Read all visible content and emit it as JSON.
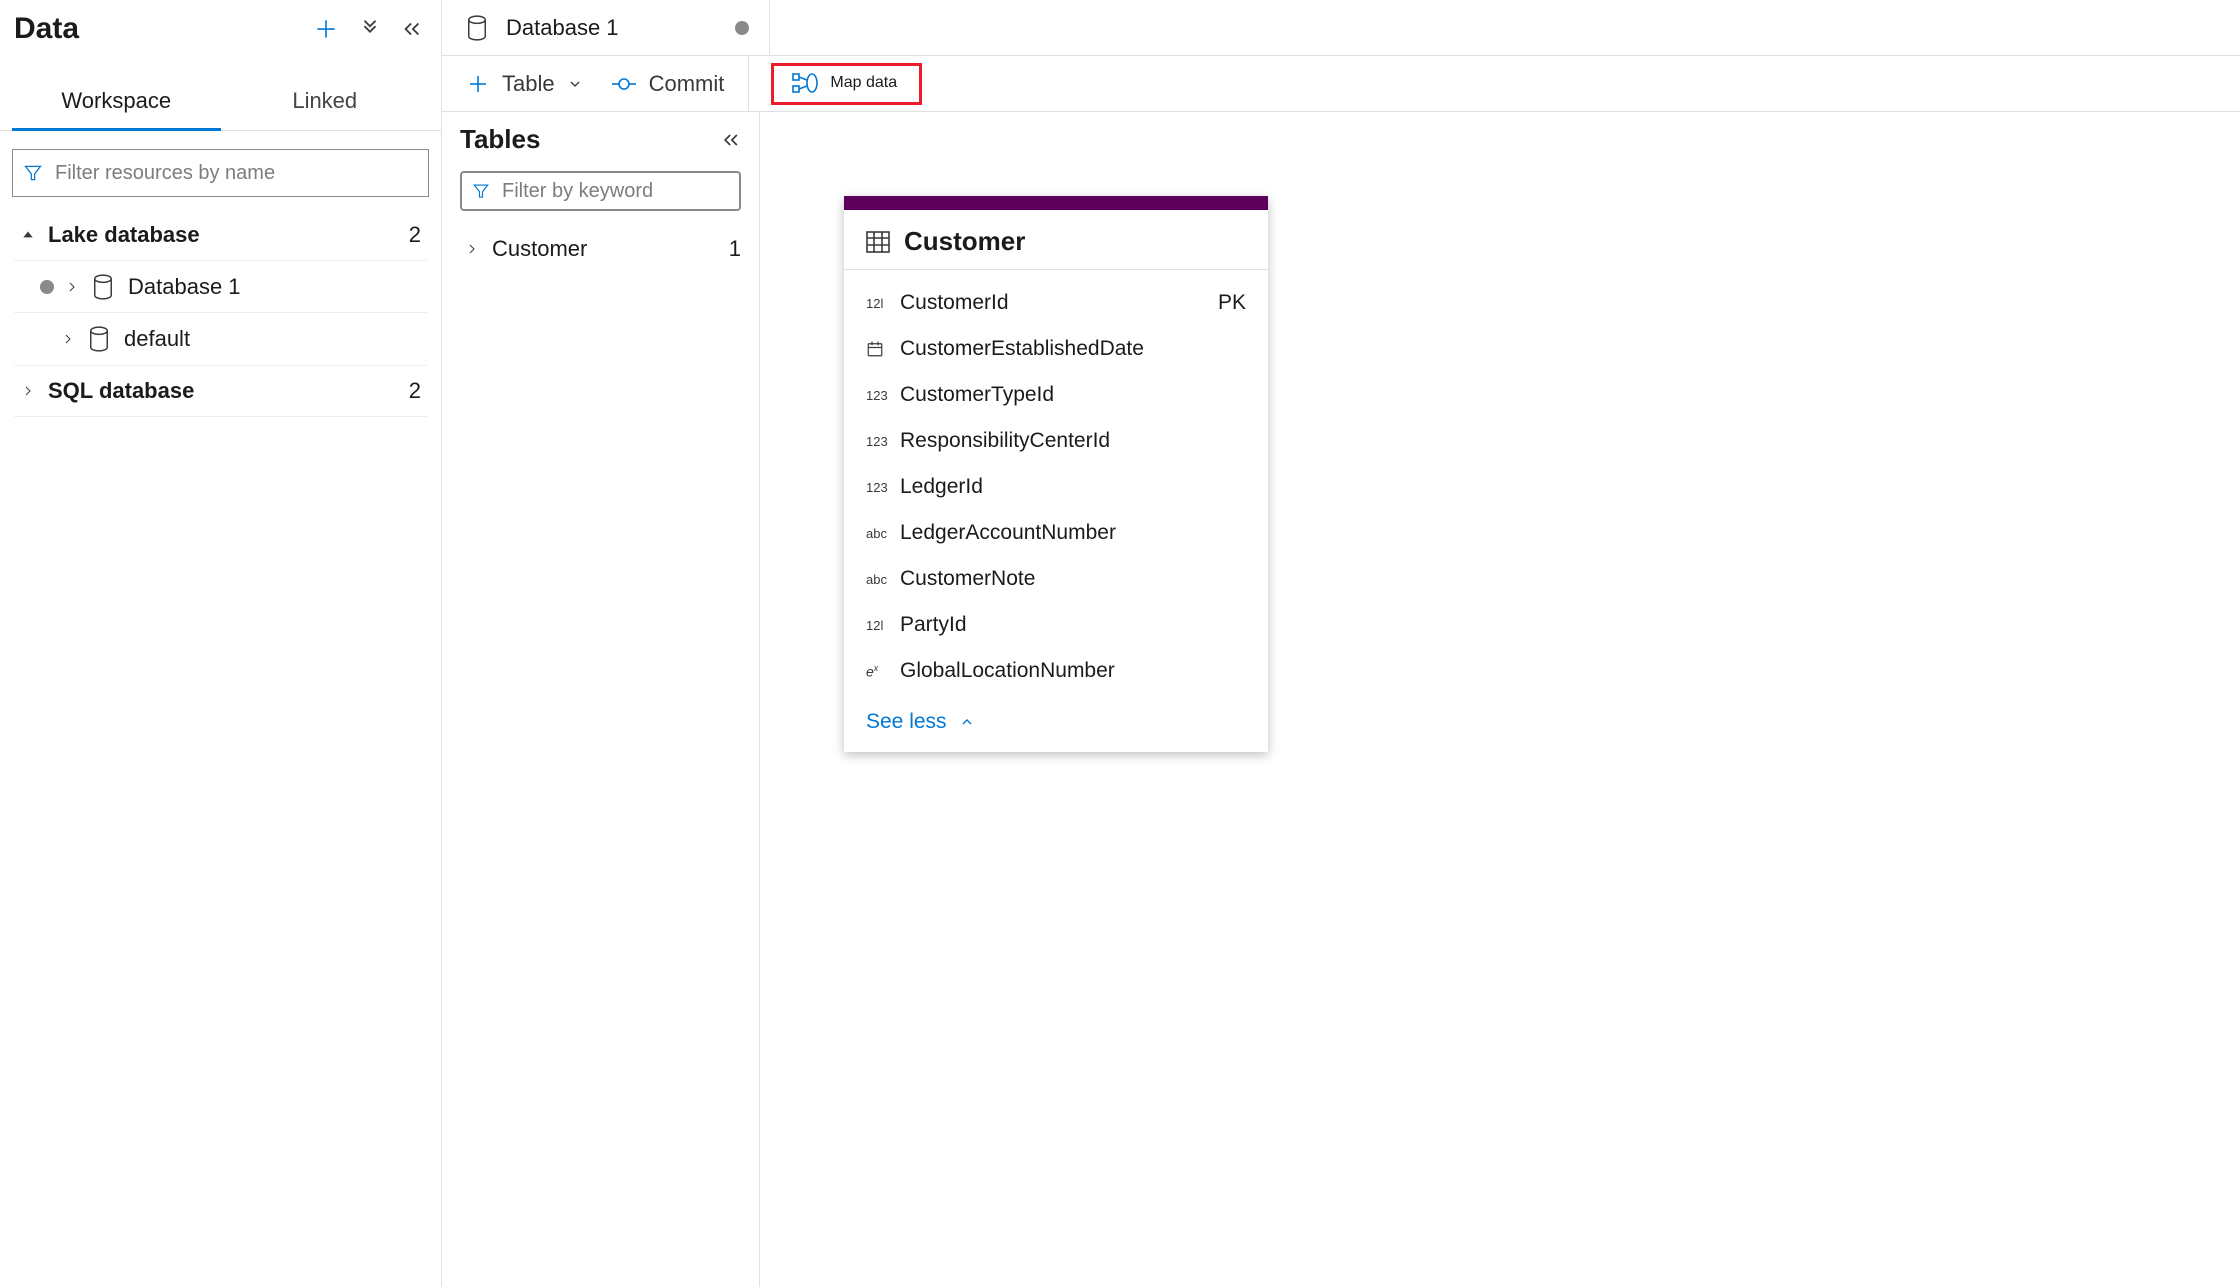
{
  "sidebar": {
    "title": "Data",
    "tabs": {
      "workspace": "Workspace",
      "linked": "Linked"
    },
    "filter_placeholder": "Filter resources by name",
    "tree": {
      "lake": {
        "label": "Lake database",
        "count": "2"
      },
      "db1": {
        "label": "Database 1"
      },
      "default": {
        "label": "default"
      },
      "sql": {
        "label": "SQL database",
        "count": "2"
      }
    }
  },
  "main": {
    "active_tab": "Database 1",
    "toolbar": {
      "table": "Table",
      "commit": "Commit",
      "mapdata": "Map data"
    },
    "tables": {
      "title": "Tables",
      "filter_placeholder": "Filter by keyword",
      "customer": {
        "label": "Customer",
        "count": "1"
      }
    },
    "entity": {
      "name": "Customer",
      "see_less": "See less",
      "cols": [
        {
          "type": "12l",
          "name": "CustomerId",
          "key": "PK"
        },
        {
          "type": "date",
          "name": "CustomerEstablishedDate",
          "key": ""
        },
        {
          "type": "123",
          "name": "CustomerTypeId",
          "key": ""
        },
        {
          "type": "123",
          "name": "ResponsibilityCenterId",
          "key": ""
        },
        {
          "type": "123",
          "name": "LedgerId",
          "key": ""
        },
        {
          "type": "abc",
          "name": "LedgerAccountNumber",
          "key": ""
        },
        {
          "type": "abc",
          "name": "CustomerNote",
          "key": ""
        },
        {
          "type": "12l",
          "name": "PartyId",
          "key": ""
        },
        {
          "type": "ex",
          "name": "GlobalLocationNumber",
          "key": ""
        }
      ]
    }
  }
}
